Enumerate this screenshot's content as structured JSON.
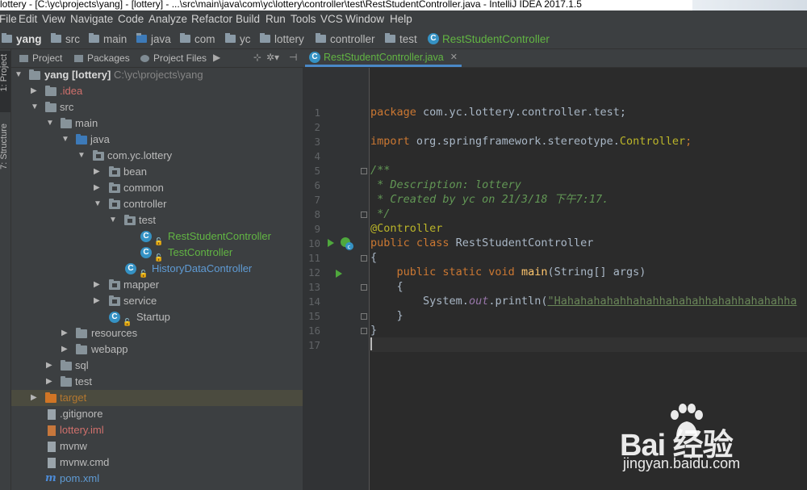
{
  "window": {
    "title": "lottery - [C:\\yc\\projects\\yang] - [lottery] - ...\\src\\main\\java\\com\\yc\\lottery\\controller\\test\\RestStudentController.java - IntelliJ IDEA 2017.1.5"
  },
  "menu": [
    "File",
    "Edit",
    "View",
    "Navigate",
    "Code",
    "Analyze",
    "Refactor",
    "Build",
    "Run",
    "Tools",
    "VCS",
    "Window",
    "Help"
  ],
  "breadcrumb": [
    "yang",
    "src",
    "main",
    "java",
    "com",
    "yc",
    "lottery",
    "controller",
    "test",
    "RestStudentController"
  ],
  "side_tabs": {
    "project": "1: Project",
    "structure": "7: Structure"
  },
  "project_panel": {
    "tabs": [
      "Project",
      "Packages",
      "Project Files"
    ],
    "root_label": "yang [lottery]",
    "root_path": "C:\\yc\\projects\\yang",
    "tree": [
      {
        "label": ".idea"
      },
      {
        "label": "src"
      },
      {
        "label": "main"
      },
      {
        "label": "java"
      },
      {
        "label": "com.yc.lottery"
      },
      {
        "label": "bean"
      },
      {
        "label": "common"
      },
      {
        "label": "controller"
      },
      {
        "label": "test"
      },
      {
        "label": "RestStudentController"
      },
      {
        "label": "TestController"
      },
      {
        "label": "HistoryDataController"
      },
      {
        "label": "mapper"
      },
      {
        "label": "service"
      },
      {
        "label": "Startup"
      },
      {
        "label": "resources"
      },
      {
        "label": "webapp"
      },
      {
        "label": "sql"
      },
      {
        "label": "test"
      },
      {
        "label": "target"
      },
      {
        "label": ".gitignore"
      },
      {
        "label": "lottery.iml"
      },
      {
        "label": "mvnw"
      },
      {
        "label": "mvnw.cmd"
      },
      {
        "label": "pom.xml"
      }
    ]
  },
  "editor": {
    "tab_label": "RestStudentController.java",
    "line_numbers": [
      "1",
      "2",
      "3",
      "4",
      "5",
      "6",
      "7",
      "8",
      "9",
      "10",
      "11",
      "12",
      "13",
      "14",
      "15",
      "16",
      "17"
    ],
    "code": {
      "l1_kw": "package",
      "l1_rest": " com.yc.lottery.controller.test;",
      "l3_kw": "import",
      "l3_pkg": " org.springframework.stereotype.",
      "l3_cls": "Controller",
      "l3_end": ";",
      "l5": "/**",
      "l6": " * Description: lottery",
      "l7": " * Created by yc on 21/3/18 下午7:17.",
      "l8": " */",
      "l9": "@Controller",
      "l10_kw": "public class",
      "l10_rest": " RestStudentController",
      "l11": "{",
      "l12_kw": "public static void",
      "l12_fn": "main",
      "l12_rest": "(String[] args)",
      "l13": "{",
      "l14_a": "System.",
      "l14_out": "out",
      "l14_b": ".println(",
      "l14_str": "\"Hahahahahahhahahhahahahhahahhahahahha",
      "l15": "}",
      "l16": "}"
    }
  },
  "watermark": {
    "logo": "Bai 经验",
    "url": "jingyan.baidu.com"
  }
}
